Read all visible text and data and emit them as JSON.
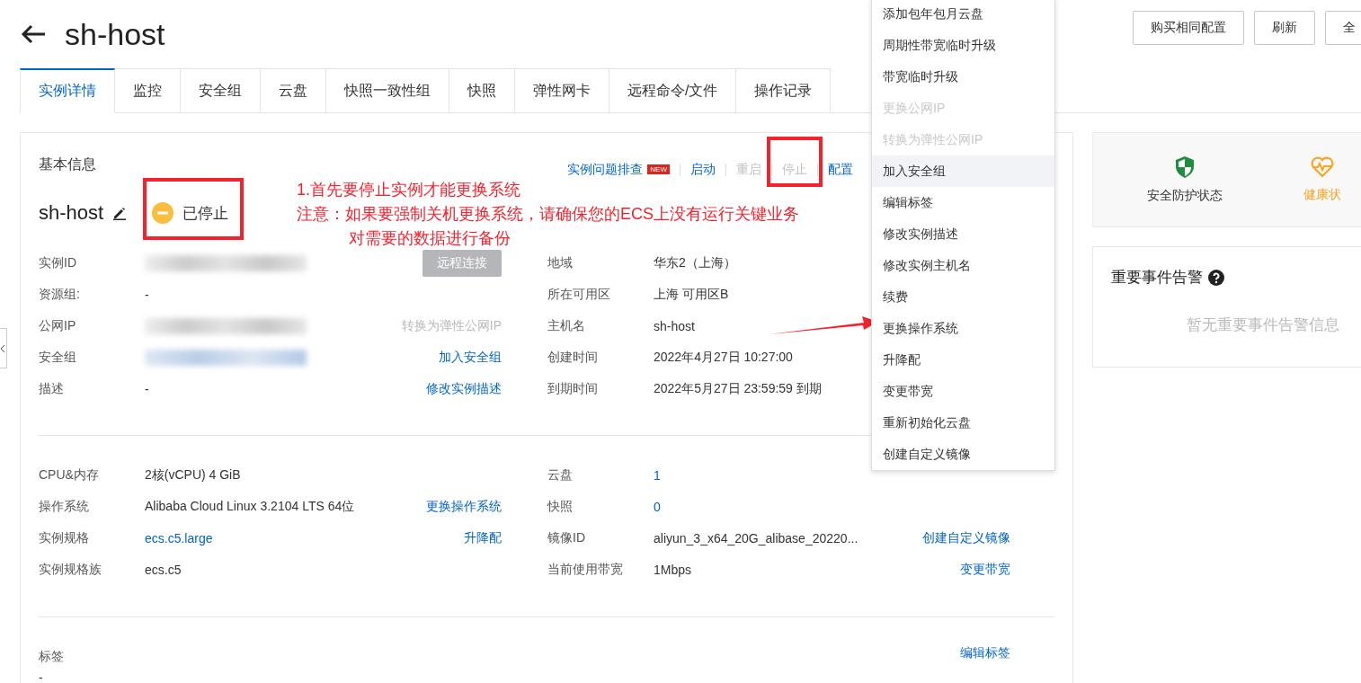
{
  "header": {
    "title": "sh-host",
    "buttons": [
      "购买相同配置",
      "刷新",
      "全"
    ]
  },
  "tabs": [
    {
      "label": "实例详情",
      "selected": true
    },
    {
      "label": "监控",
      "selected": false
    },
    {
      "label": "安全组",
      "selected": false
    },
    {
      "label": "云盘",
      "selected": false
    },
    {
      "label": "快照一致性组",
      "selected": false
    },
    {
      "label": "快照",
      "selected": false
    },
    {
      "label": "弹性网卡",
      "selected": false
    },
    {
      "label": "远程命令/文件",
      "selected": false
    },
    {
      "label": "操作记录",
      "selected": false
    }
  ],
  "basic_info": {
    "title": "基本信息",
    "actions": [
      {
        "label": "实例问题排查",
        "badge": "NEW",
        "disabled": false
      },
      {
        "label": "启动",
        "disabled": false
      },
      {
        "label": "重启",
        "disabled": true
      },
      {
        "label": "停止",
        "disabled": true
      },
      {
        "label": "配置",
        "disabled": false
      }
    ],
    "name": "sh-host",
    "status": {
      "label": "已停止",
      "kind": "stopped"
    },
    "sections": [
      {
        "left": [
          {
            "label": "实例ID",
            "value": {
              "kind": "redacted",
              "linked": false
            },
            "action": {
              "kind": "button",
              "label": "远程连接",
              "disabled": true
            }
          },
          {
            "label": "资源组:",
            "value": {
              "kind": "text",
              "text": "-"
            }
          },
          {
            "label": "公网IP",
            "value": {
              "kind": "redacted",
              "linked": false
            },
            "action": {
              "kind": "link",
              "label": "转换为弹性公网IP",
              "disabled": true
            }
          },
          {
            "label": "安全组",
            "value": {
              "kind": "redacted",
              "linked": true
            },
            "action": {
              "kind": "link",
              "label": "加入安全组",
              "disabled": false
            }
          },
          {
            "label": "描述",
            "value": {
              "kind": "text",
              "text": "-"
            },
            "action": {
              "kind": "link",
              "label": "修改实例描述",
              "disabled": false
            }
          }
        ],
        "right": [
          {
            "label": "地域",
            "value": {
              "kind": "text",
              "text": "华东2（上海）"
            }
          },
          {
            "label": "所在可用区",
            "value": {
              "kind": "text",
              "text": "上海 可用区B"
            }
          },
          {
            "label": "主机名",
            "value": {
              "kind": "text",
              "text": "sh-host"
            }
          },
          {
            "label": "创建时间",
            "value": {
              "kind": "text",
              "text": "2022年4月27日 10:27:00"
            }
          },
          {
            "label": "到期时间",
            "value": {
              "kind": "text",
              "text": "2022年5月27日 23:59:59 到期"
            }
          }
        ]
      },
      {
        "left": [
          {
            "label": "CPU&内存",
            "value": {
              "kind": "text",
              "text": "2核(vCPU) 4 GiB"
            }
          },
          {
            "label": "操作系统",
            "value": {
              "kind": "text",
              "text": "Alibaba Cloud Linux 3.2104 LTS 64位"
            },
            "action": {
              "kind": "link",
              "label": "更换操作系统",
              "disabled": false
            }
          },
          {
            "label": "实例规格",
            "value": {
              "kind": "link",
              "text": "ecs.c5.large"
            },
            "action": {
              "kind": "link",
              "label": "升降配",
              "disabled": false
            }
          },
          {
            "label": "实例规格族",
            "value": {
              "kind": "text",
              "text": "ecs.c5"
            }
          }
        ],
        "right": [
          {
            "label": "云盘",
            "value": {
              "kind": "link",
              "text": "1"
            }
          },
          {
            "label": "快照",
            "value": {
              "kind": "link",
              "text": "0"
            }
          },
          {
            "label": "镜像ID",
            "value": {
              "kind": "text",
              "text": "aliyun_3_x64_20G_alibase_20220..."
            },
            "action": {
              "kind": "link",
              "label": "创建自定义镜像",
              "disabled": false
            }
          },
          {
            "label": "当前使用带宽",
            "value": {
              "kind": "text",
              "text": "1Mbps"
            },
            "action": {
              "kind": "link",
              "label": "变更带宽",
              "disabled": false
            }
          }
        ]
      }
    ],
    "tags": {
      "label": "标签",
      "value": "-",
      "action": "编辑标签"
    }
  },
  "side": {
    "protection": [
      {
        "label": "安全防护状态",
        "kind": "shield"
      },
      {
        "label": "健康状",
        "kind": "health"
      }
    ],
    "alerts": {
      "title": "重要事件告警",
      "empty": "暂无重要事件告警信息"
    }
  },
  "menu": {
    "items": [
      {
        "label": "添加包年包月云盘",
        "disabled": false,
        "highlighted": false
      },
      {
        "label": "周期性带宽临时升级",
        "disabled": false,
        "highlighted": false
      },
      {
        "label": "带宽临时升级",
        "disabled": false,
        "highlighted": false
      },
      {
        "label": "更换公网IP",
        "disabled": true,
        "highlighted": false
      },
      {
        "label": "转换为弹性公网IP",
        "disabled": true,
        "highlighted": false
      },
      {
        "label": "加入安全组",
        "disabled": false,
        "highlighted": true
      },
      {
        "label": "编辑标签",
        "disabled": false,
        "highlighted": false
      },
      {
        "label": "修改实例描述",
        "disabled": false,
        "highlighted": false
      },
      {
        "label": "修改实例主机名",
        "disabled": false,
        "highlighted": false
      },
      {
        "label": "续费",
        "disabled": false,
        "highlighted": false
      },
      {
        "label": "更换操作系统",
        "disabled": false,
        "highlighted": false
      },
      {
        "label": "升降配",
        "disabled": false,
        "highlighted": false
      },
      {
        "label": "变更带宽",
        "disabled": false,
        "highlighted": false
      },
      {
        "label": "重新初始化云盘",
        "disabled": false,
        "highlighted": false
      },
      {
        "label": "创建自定义镜像",
        "disabled": false,
        "highlighted": false
      }
    ]
  },
  "annotations": {
    "notes": [
      "1.首先要停止实例才能更换系统",
      "注意：如果要强制关机更换系统，请确保您的ECS上没有运行关键业务"
    ],
    "continuation": "对需要的数据进行备份"
  }
}
